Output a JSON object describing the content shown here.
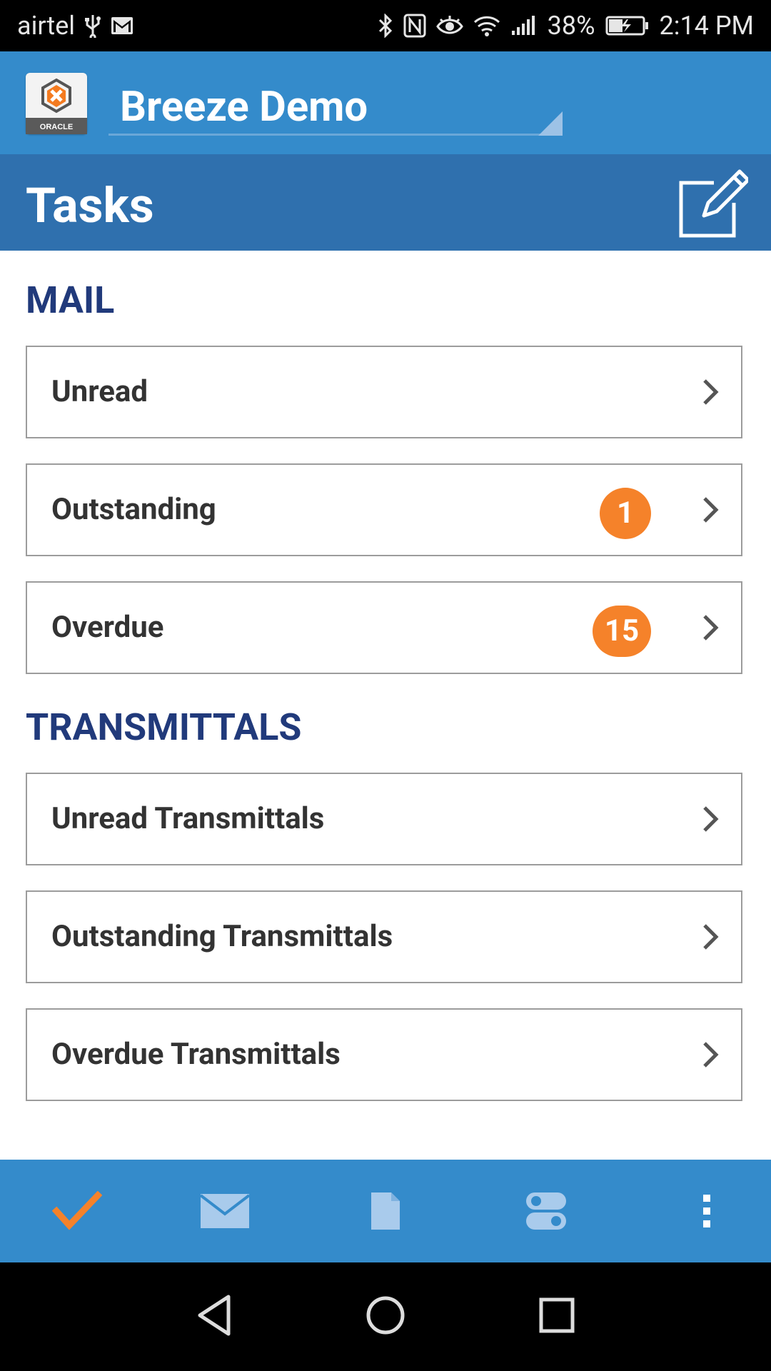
{
  "status_bar": {
    "carrier": "airtel",
    "battery_percent": "38%",
    "time": "2:14 PM"
  },
  "app_bar": {
    "project_name": "Breeze Demo",
    "logo_text": "ORACLE"
  },
  "header": {
    "title": "Tasks"
  },
  "sections": {
    "mail": {
      "title": "MAIL",
      "items": [
        {
          "label": "Unread",
          "badge": ""
        },
        {
          "label": "Outstanding",
          "badge": "1"
        },
        {
          "label": "Overdue",
          "badge": "15"
        }
      ]
    },
    "transmittals": {
      "title": "TRANSMITTALS",
      "items": [
        {
          "label": "Unread Transmittals"
        },
        {
          "label": "Outstanding Transmittals"
        },
        {
          "label": "Overdue Transmittals"
        }
      ]
    }
  },
  "bottom_nav": {
    "items": [
      {
        "icon": "checkmark-icon",
        "active": true
      },
      {
        "icon": "mail-icon",
        "active": false
      },
      {
        "icon": "document-icon",
        "active": false
      },
      {
        "icon": "toggle-icon",
        "active": false
      },
      {
        "icon": "more-vertical-icon",
        "active": false
      }
    ]
  },
  "colors": {
    "app_bar": "#348bcb",
    "tasks_bar": "#2f70ae",
    "section_title": "#213a7b",
    "badge": "#f5822a",
    "active_icon": "#f5822a"
  }
}
